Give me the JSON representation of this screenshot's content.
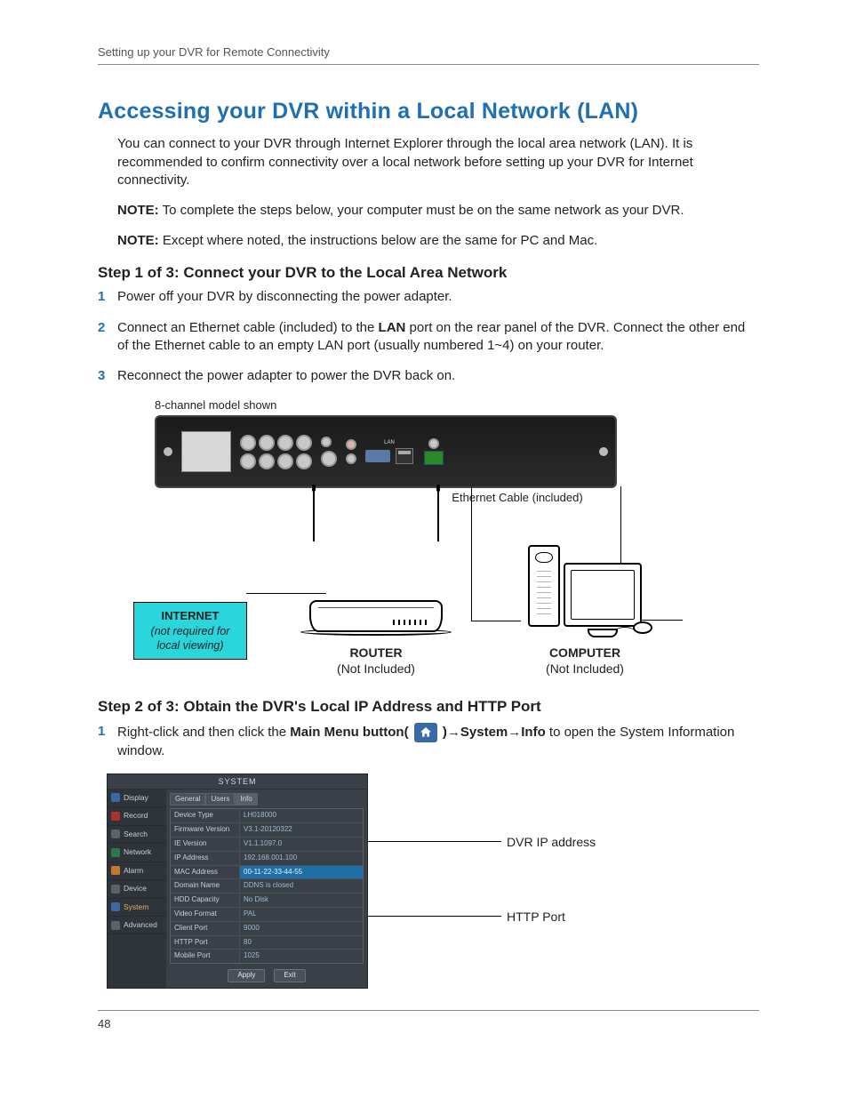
{
  "running_head": "Setting up your DVR for Remote Connectivity",
  "title": "Accessing your DVR within a Local Network (LAN)",
  "intro": "You can connect to your DVR through Internet Explorer through the local area network (LAN). It is recommended to confirm connectivity over a local network before setting up your DVR for Internet connectivity.",
  "note_label": "NOTE:",
  "note1": " To complete the steps below, your computer must be on the same network as your DVR.",
  "note2": " Except where noted, the instructions below are the same for PC and Mac.",
  "step1_heading": "Step 1 of 3: Connect your DVR to the Local Area Network",
  "step1_items": {
    "n1": "1",
    "t1": "Power off your DVR by disconnecting the power adapter.",
    "n2": "2",
    "t2a": "Connect an Ethernet cable (included) to the ",
    "t2b": "LAN",
    "t2c": " port on the rear panel of the DVR. Connect the other end of the Ethernet cable to an empty LAN port (usually numbered 1~4) on your router.",
    "n3": "3",
    "t3": "Reconnect the power adapter to power the DVR back on."
  },
  "diagram1": {
    "caption": "8-channel model shown",
    "eth_label": "Ethernet Cable (included)",
    "internet_title": "INTERNET",
    "internet_sub": "(not required for local viewing)",
    "router_label": "ROUTER",
    "router_sub": "(Not Included)",
    "computer_label": "COMPUTER",
    "computer_sub": "(Not Included)"
  },
  "step2_heading": "Step 2 of 3: Obtain the DVR's Local IP Address and HTTP Port",
  "step2_items": {
    "n1": "1",
    "t1a": "Right-click and then click the ",
    "t1b": "Main Menu button( ",
    "t1c": " )→System→Info",
    "t1d": " to open the System Information window."
  },
  "syswin": {
    "title": "SYSTEM",
    "sidebar": [
      "Display",
      "Record",
      "Search",
      "Network",
      "Alarm",
      "Device",
      "System",
      "Advanced"
    ],
    "tabs": [
      "General",
      "Users",
      "Info"
    ],
    "rows": [
      {
        "k": "Device Type",
        "v": "LH018000"
      },
      {
        "k": "Firmware Version",
        "v": "V3.1-20120322"
      },
      {
        "k": "IE Version",
        "v": "V1.1.1097.0"
      },
      {
        "k": "IP Address",
        "v": "192.168.001.100"
      },
      {
        "k": "MAC Address",
        "v": "00-11-22-33-44-55",
        "hl": true
      },
      {
        "k": "Domain Name",
        "v": "DDNS is closed"
      },
      {
        "k": "HDD Capacity",
        "v": "No Disk"
      },
      {
        "k": "Video Format",
        "v": "PAL"
      },
      {
        "k": "Client Port",
        "v": "9000"
      },
      {
        "k": "HTTP Port",
        "v": "80"
      },
      {
        "k": "Mobile Port",
        "v": "1025"
      }
    ],
    "btn_apply": "Apply",
    "btn_exit": "Exit",
    "callout_ip": "DVR IP address",
    "callout_http": "HTTP Port"
  },
  "page_num": "48"
}
